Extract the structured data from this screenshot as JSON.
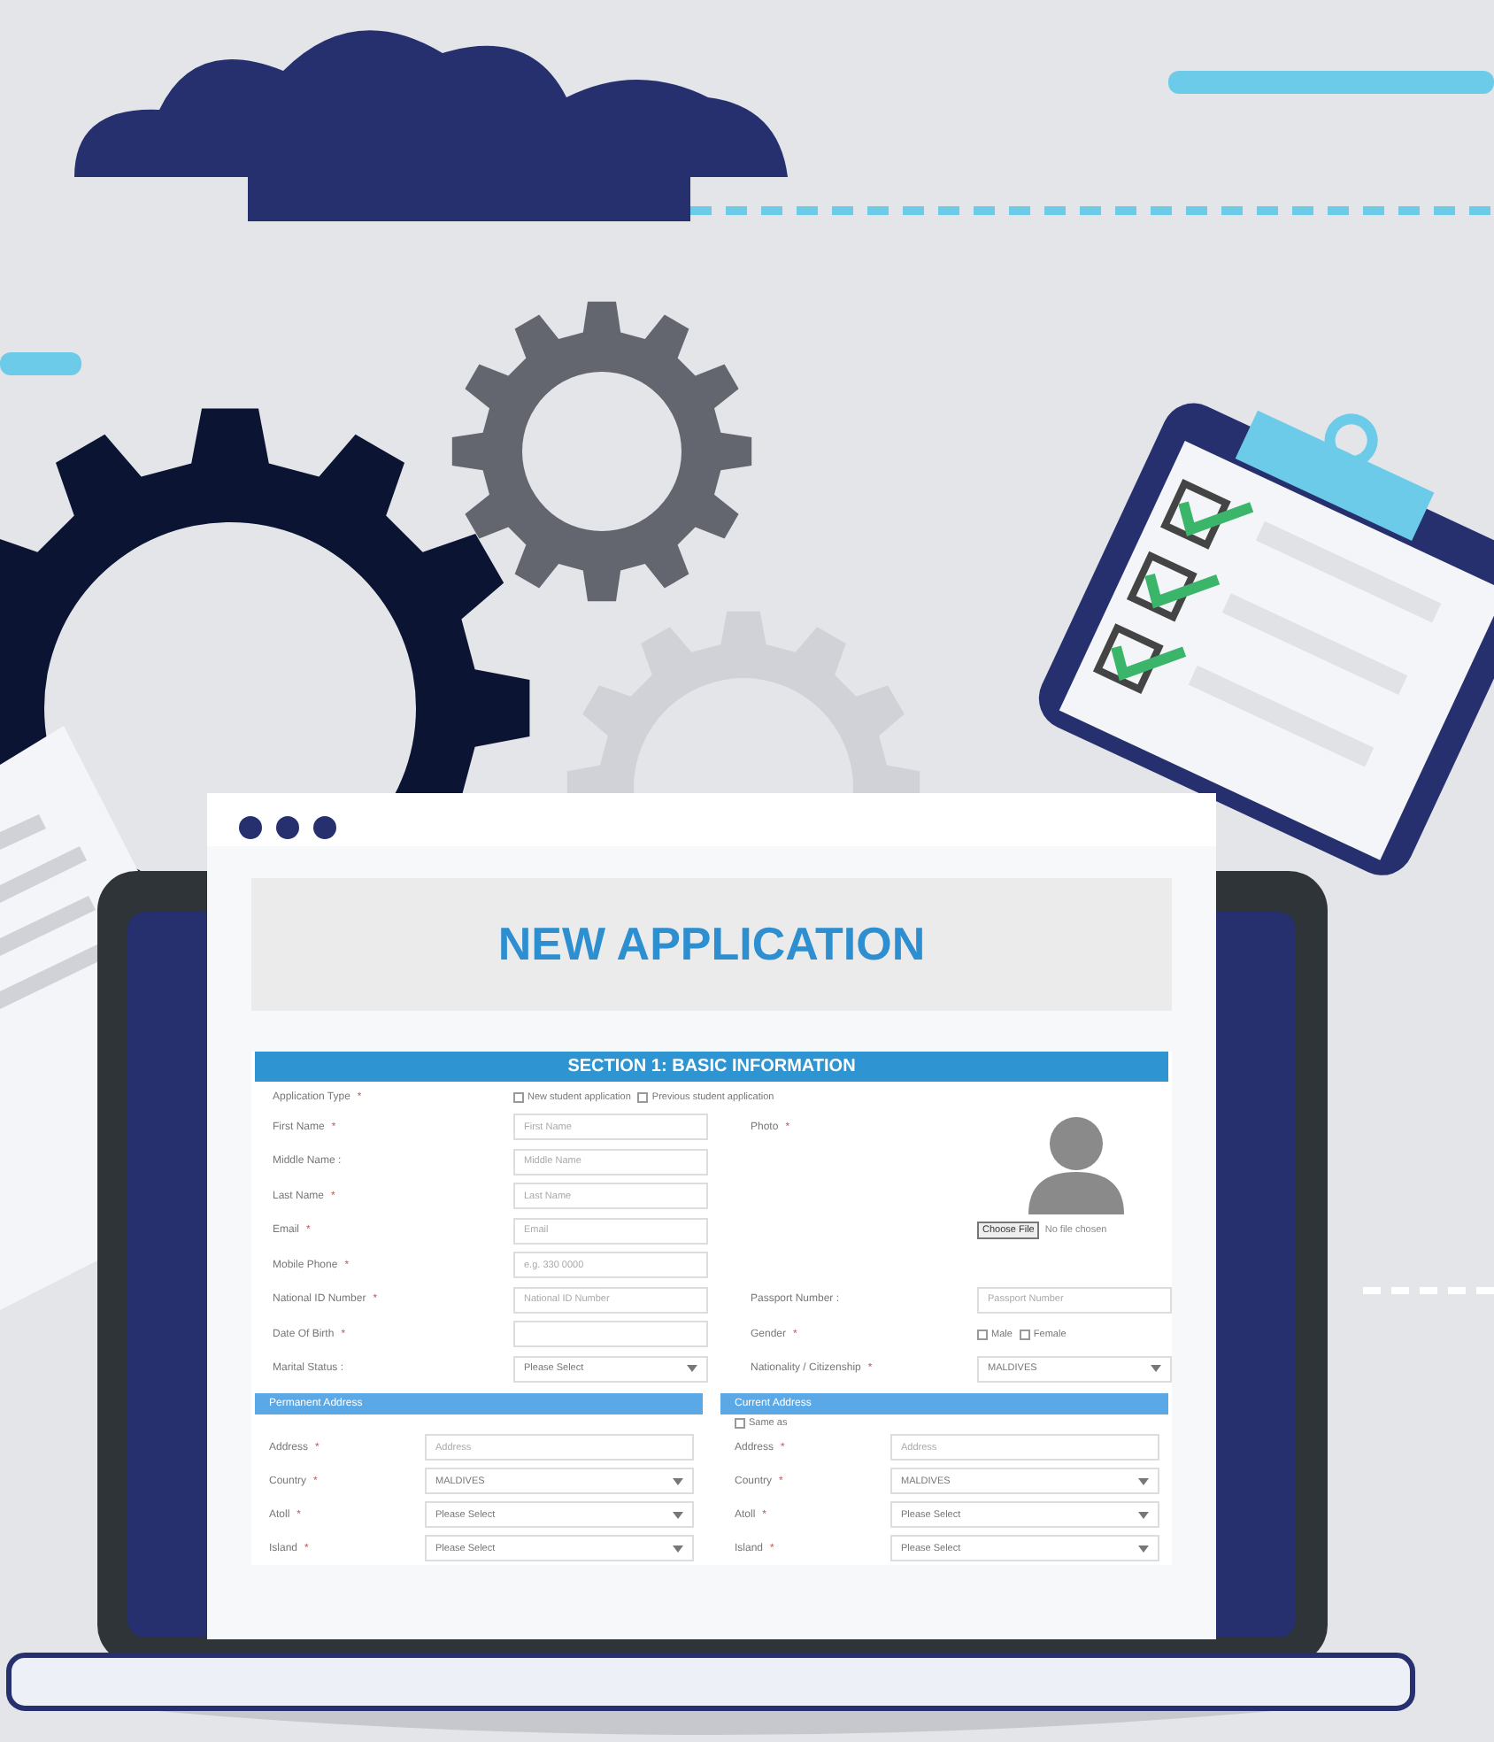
{
  "window": {
    "title": "NEW APPLICATION"
  },
  "section": {
    "title": "SECTION 1: BASIC INFORMATION"
  },
  "application_type": {
    "label": "Application Type",
    "required_mark": "*",
    "options": [
      {
        "label": "New student application",
        "checked": false
      },
      {
        "label": "Previous student application",
        "checked": false
      }
    ]
  },
  "left_fields": [
    {
      "kind": "input",
      "label": "First Name",
      "required_mark": "*",
      "placeholder": "First Name"
    },
    {
      "kind": "input",
      "label": "Middle Name :",
      "placeholder": "Middle Name"
    },
    {
      "kind": "input",
      "label": "Last Name",
      "required_mark": "*",
      "placeholder": "Last Name"
    },
    {
      "kind": "input",
      "label": "Email",
      "required_mark": "*",
      "placeholder": "Email"
    },
    {
      "kind": "input",
      "label": "Mobile Phone",
      "required_mark": "*",
      "placeholder": "e.g. 330 0000"
    },
    {
      "kind": "input",
      "label": "National ID Number",
      "required_mark": "*",
      "placeholder": "National ID Number"
    },
    {
      "kind": "input",
      "label": "Date Of Birth",
      "required_mark": "*"
    },
    {
      "kind": "select",
      "label": "Marital Status :",
      "value": "Please Select"
    }
  ],
  "photo": {
    "label": "Photo",
    "required_mark": "*",
    "button": "Choose File",
    "file_status": "No file chosen"
  },
  "right_fields": [
    {
      "kind": "input",
      "label": "Passport Number :",
      "placeholder": "Passport Number"
    },
    {
      "kind": "radio",
      "label": "Gender",
      "required_mark": "*",
      "options": [
        {
          "label": "Male",
          "selected": false
        },
        {
          "label": "Female",
          "selected": false
        }
      ]
    },
    {
      "kind": "select",
      "label": "Nationality / Citizenship",
      "required_mark": "*",
      "value": "MALDIVES"
    }
  ],
  "addresses": [
    {
      "title": "Permanent Address",
      "fields": [
        {
          "kind": "input",
          "label": "Address",
          "required_mark": "*",
          "placeholder": "Address"
        },
        {
          "kind": "select",
          "label": "Country",
          "required_mark": "*",
          "value": "MALDIVES"
        },
        {
          "kind": "select",
          "label": "Atoll",
          "required_mark": "*",
          "value": "Please Select"
        },
        {
          "kind": "select",
          "label": "Island",
          "required_mark": "*",
          "value": "Please Select"
        }
      ]
    },
    {
      "title": "Current Address",
      "same_as": {
        "label": "Same as",
        "checked": false
      },
      "fields": [
        {
          "kind": "input",
          "label": "Address",
          "required_mark": "*",
          "placeholder": "Address"
        },
        {
          "kind": "select",
          "label": "Country",
          "required_mark": "*",
          "value": "MALDIVES"
        },
        {
          "kind": "select",
          "label": "Atoll",
          "required_mark": "*",
          "value": "Please Select"
        },
        {
          "kind": "select",
          "label": "Island",
          "required_mark": "*",
          "value": "Please Select"
        }
      ]
    }
  ]
}
